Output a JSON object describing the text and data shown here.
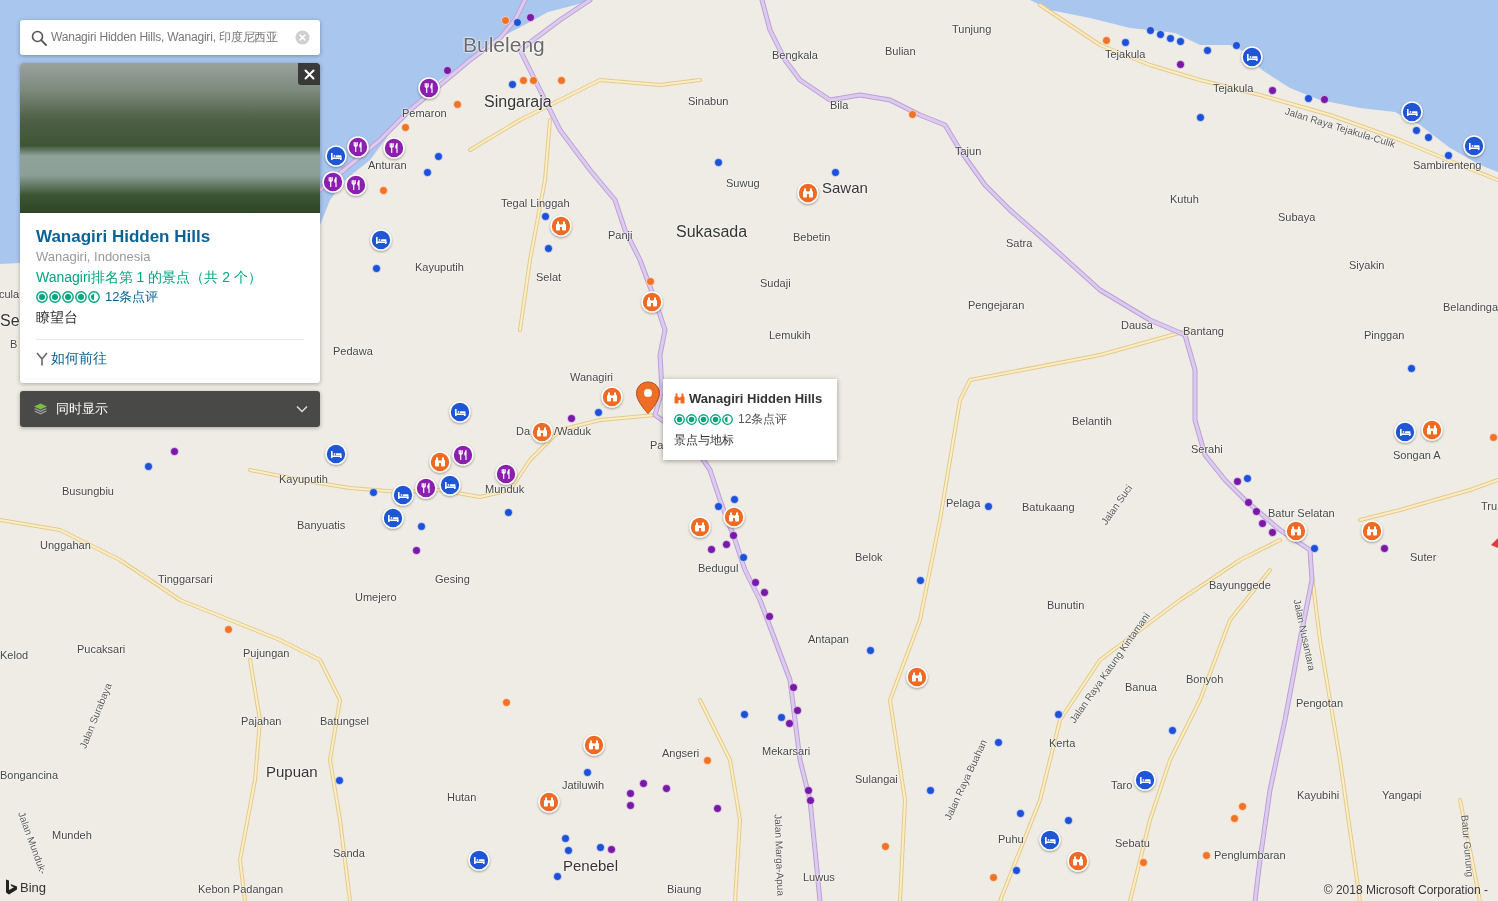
{
  "search": {
    "value": "Wanagiri Hidden Hills, Wanagiri, 印度尼西亚"
  },
  "place_card": {
    "title": "Wanagiri Hidden Hills",
    "location": "Wanagiri, Indonesia",
    "ranking": "Wanagiri排名第 1 的景点（共 2 个）",
    "stars": 4.5,
    "reviews": "12条点评",
    "category": "瞭望台",
    "directions": "如何前往"
  },
  "layers_dropdown": {
    "label": "同时显示",
    "expanded": false
  },
  "popup": {
    "title": "Wanagiri Hidden Hills",
    "stars": 4.5,
    "reviews": "12条点评",
    "category": "景点与地标"
  },
  "map_labels": [
    {
      "text": "Buleleng",
      "kind": "region"
    },
    {
      "text": "Singaraja",
      "kind": "city"
    },
    {
      "text": "Pemaron",
      "kind": "village"
    },
    {
      "text": "Anturan",
      "kind": "village"
    },
    {
      "text": "Tegal Linggah",
      "kind": "village"
    },
    {
      "text": "Panji",
      "kind": "village"
    },
    {
      "text": "Sukasada",
      "kind": "city"
    },
    {
      "text": "Kayuputih",
      "kind": "village"
    },
    {
      "text": "Selat",
      "kind": "village"
    },
    {
      "text": "Sinabun",
      "kind": "village"
    },
    {
      "text": "Bengkala",
      "kind": "village"
    },
    {
      "text": "Bulian",
      "kind": "village"
    },
    {
      "text": "Tunjung",
      "kind": "village"
    },
    {
      "text": "Bila",
      "kind": "village"
    },
    {
      "text": "Suwug",
      "kind": "village"
    },
    {
      "text": "Sawan",
      "kind": "town"
    },
    {
      "text": "Tajun",
      "kind": "village"
    },
    {
      "text": "Bebetin",
      "kind": "village"
    },
    {
      "text": "Sudaji",
      "kind": "village"
    },
    {
      "text": "Lemukih",
      "kind": "village"
    },
    {
      "text": "Satra",
      "kind": "village"
    },
    {
      "text": "Pengejaran",
      "kind": "village"
    },
    {
      "text": "Kutuh",
      "kind": "village"
    },
    {
      "text": "Subaya",
      "kind": "village"
    },
    {
      "text": "Siyakin",
      "kind": "village"
    },
    {
      "text": "Dausa",
      "kind": "village"
    },
    {
      "text": "Bantang",
      "kind": "village"
    },
    {
      "text": "Pinggan",
      "kind": "village"
    },
    {
      "text": "Belandinga",
      "kind": "village"
    },
    {
      "text": "Tejakula",
      "kind": "village"
    },
    {
      "text": "Tejakula",
      "kind": "village"
    },
    {
      "text": "Jalan Raya Tejakula-Culik",
      "kind": "road"
    },
    {
      "text": "Sambirenteng",
      "kind": "village"
    },
    {
      "text": "Pedawa",
      "kind": "village"
    },
    {
      "text": "Wanagiri",
      "kind": "village"
    },
    {
      "text": "Da",
      "kind": "village"
    },
    {
      "text": "/Waduk",
      "kind": "village"
    },
    {
      "text": "Pa",
      "kind": "village"
    },
    {
      "text": "Kayuputih",
      "kind": "village"
    },
    {
      "text": "Munduk",
      "kind": "village"
    },
    {
      "text": "Busungbiu",
      "kind": "village"
    },
    {
      "text": "Banyuatis",
      "kind": "village"
    },
    {
      "text": "Unggahan",
      "kind": "village"
    },
    {
      "text": "Tinggarsari",
      "kind": "village"
    },
    {
      "text": "Umejero",
      "kind": "village"
    },
    {
      "text": "Gesing",
      "kind": "village"
    },
    {
      "text": "Bedugul",
      "kind": "village"
    },
    {
      "text": "Belok",
      "kind": "village"
    },
    {
      "text": "Pelaga",
      "kind": "village"
    },
    {
      "text": "Batukaang",
      "kind": "village"
    },
    {
      "text": "Jalan Suci",
      "kind": "road"
    },
    {
      "text": "Belantih",
      "kind": "village"
    },
    {
      "text": "Serahi",
      "kind": "village"
    },
    {
      "text": "Songan A",
      "kind": "village"
    },
    {
      "text": "Batur Selatan",
      "kind": "village"
    },
    {
      "text": "Suter",
      "kind": "village"
    },
    {
      "text": "Bayunggede",
      "kind": "village"
    },
    {
      "text": "Bunutin",
      "kind": "village"
    },
    {
      "text": "Jalan Nusantara",
      "kind": "road"
    },
    {
      "text": "Jalan Raya Katung Kintamani",
      "kind": "road"
    },
    {
      "text": "Antapan",
      "kind": "village"
    },
    {
      "text": "Tru",
      "kind": "village"
    },
    {
      "text": "Kelod",
      "kind": "village"
    },
    {
      "text": "Pucaksari",
      "kind": "village"
    },
    {
      "text": "Pujungan",
      "kind": "village"
    },
    {
      "text": "Jalan Surabaya",
      "kind": "road"
    },
    {
      "text": "Pajahan",
      "kind": "village"
    },
    {
      "text": "Batungsel",
      "kind": "village"
    },
    {
      "text": "Bongancina",
      "kind": "village"
    },
    {
      "text": "Pupuan",
      "kind": "town"
    },
    {
      "text": "Angseri",
      "kind": "village"
    },
    {
      "text": "Mekarsari",
      "kind": "village"
    },
    {
      "text": "Sulangai",
      "kind": "village"
    },
    {
      "text": "Jatiluwih",
      "kind": "village"
    },
    {
      "text": "Hutan",
      "kind": "village"
    },
    {
      "text": "Banua",
      "kind": "village"
    },
    {
      "text": "Bonyoh",
      "kind": "village"
    },
    {
      "text": "Pengotan",
      "kind": "village"
    },
    {
      "text": "Kerta",
      "kind": "village"
    },
    {
      "text": "Jalan Raya Buahan",
      "kind": "road"
    },
    {
      "text": "Taro",
      "kind": "village"
    },
    {
      "text": "Kayubihi",
      "kind": "village"
    },
    {
      "text": "Yangapi",
      "kind": "village"
    },
    {
      "text": "Mundeh",
      "kind": "village"
    },
    {
      "text": "Sanda",
      "kind": "village"
    },
    {
      "text": "Penebel",
      "kind": "town"
    },
    {
      "text": "Puhu",
      "kind": "village"
    },
    {
      "text": "Sebatu",
      "kind": "village"
    },
    {
      "text": "Penglumbaran",
      "kind": "village"
    },
    {
      "text": "Jalan Marga-Apua",
      "kind": "road"
    },
    {
      "text": "Biaung",
      "kind": "village"
    },
    {
      "text": "Luwus",
      "kind": "village"
    },
    {
      "text": "Kebon Padangan",
      "kind": "village"
    },
    {
      "text": "Jalan Munduk-",
      "kind": "road"
    },
    {
      "text": "Batur Gunung",
      "kind": "road"
    },
    {
      "text": "cula",
      "kind": "village"
    },
    {
      "text": "Se",
      "kind": "city"
    },
    {
      "text": "B",
      "kind": "village"
    }
  ],
  "attribution": {
    "logo": "Bing",
    "copyright": "© 2018 Microsoft Corporation -"
  }
}
